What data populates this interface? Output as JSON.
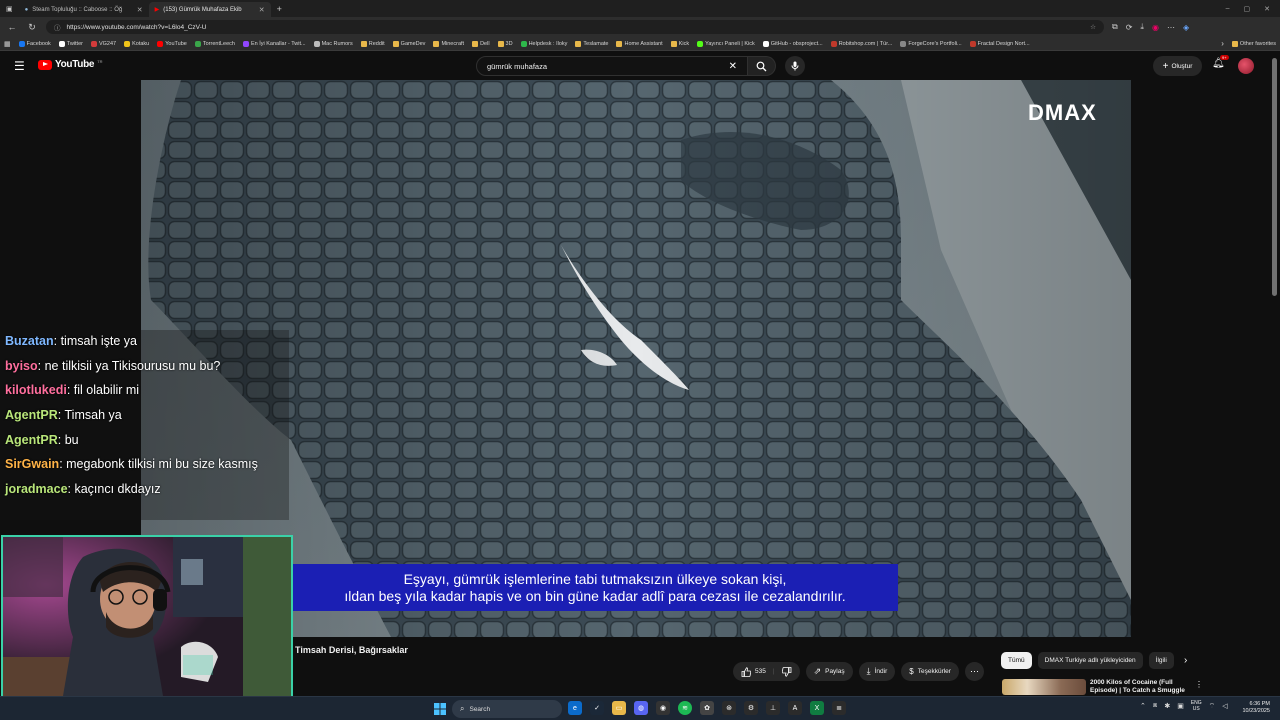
{
  "browser": {
    "tabs": [
      {
        "title": "Steam Topluluğu :: Caboose :: Öğ",
        "active": false
      },
      {
        "title": "(153) Gümrük Muhafaza Ekib",
        "active": true
      }
    ],
    "new_tab": "+",
    "window_controls": [
      "–",
      "▢",
      "✕"
    ],
    "url": "https://www.youtube.com/watch?v=L6lo4_CzV-U",
    "bookmarks": [
      {
        "label": "Facebook",
        "icon": "facebook-icon",
        "color": "#1877f2"
      },
      {
        "label": "Twitter",
        "icon": "x-icon",
        "color": "#ffffff"
      },
      {
        "label": "VG247",
        "icon": "vg247-icon",
        "color": "#d23b3b"
      },
      {
        "label": "Kotaku",
        "icon": "kotaku-icon",
        "color": "#f0c419"
      },
      {
        "label": "YouTube",
        "icon": "youtube-icon",
        "color": "#ff0000"
      },
      {
        "label": "TorrentLeech",
        "icon": "torrentleech-icon",
        "color": "#3aa64a"
      },
      {
        "label": "En İyi Kanallar - Twit...",
        "icon": "twitch-icon",
        "color": "#9146ff"
      },
      {
        "label": "Mac Rumors",
        "icon": "apple-icon",
        "color": "#bbbbbb"
      },
      {
        "label": "Reddit",
        "icon": "folder-icon",
        "color": "#e8b84a",
        "folder": true
      },
      {
        "label": "GameDev",
        "icon": "folder-icon",
        "color": "#e8b84a",
        "folder": true
      },
      {
        "label": "Minecraft",
        "icon": "folder-icon",
        "color": "#e8b84a",
        "folder": true
      },
      {
        "label": "Dell",
        "icon": "folder-icon",
        "color": "#e8b84a",
        "folder": true
      },
      {
        "label": "3D",
        "icon": "folder-icon",
        "color": "#e8b84a",
        "folder": true
      },
      {
        "label": "Helpdesk : Iloky",
        "icon": "helpdesk-icon",
        "color": "#2eb84b"
      },
      {
        "label": "Teslamate",
        "icon": "folder-icon",
        "color": "#e8b84a",
        "folder": true
      },
      {
        "label": "Home Assistant",
        "icon": "folder-icon",
        "color": "#e8b84a",
        "folder": true
      },
      {
        "label": "Kick",
        "icon": "folder-icon",
        "color": "#e8b84a",
        "folder": true
      },
      {
        "label": "Yayıncı Paneli | Kick",
        "icon": "kick-icon",
        "color": "#53fc18"
      },
      {
        "label": "GitHub - obsproject...",
        "icon": "github-icon",
        "color": "#ffffff"
      },
      {
        "label": "Robitshop.com | Tür...",
        "icon": "robitshop-icon",
        "color": "#c0392b"
      },
      {
        "label": "ForgeCore's Portfoli...",
        "icon": "forgecore-icon",
        "color": "#888888"
      },
      {
        "label": "Fractal Design Nort...",
        "icon": "fractal-icon",
        "color": "#c0392b"
      }
    ],
    "other_favorites": "Other favorites"
  },
  "youtube": {
    "logo_text": "YouTube",
    "logo_region": "TR",
    "search_query": "gümrük muhafaza",
    "create_label": "Oluştur",
    "notification_count": "9+",
    "video": {
      "watermark": "DMAX",
      "subtitle_lines": [
        "Eşyayı, gümrük işlemlerine tabi tutmaksızın ülkeye sokan kişi,",
        "ıldan beş yıla kadar hapis ve on bin güne kadar adlî para cezası ile cezalandırılır."
      ]
    },
    "video_title": "Timsah Derisi, Bağırsaklar",
    "actions": {
      "likes": "535",
      "share": "Paylaş",
      "download": "İndir",
      "thanks": "Teşekkürler",
      "more": "⋯"
    },
    "chips": [
      "Tümü",
      "DMAX Turkiye adlı yükleyiciden",
      "İlgili"
    ],
    "recommendation_title": "2000 Kilos of Cocaine (Full Episode) | To Catch a Smuggle"
  },
  "chat": [
    {
      "user": "Buzatan",
      "color": "#7fb8ff",
      "text": "timsah işte ya"
    },
    {
      "user": "byiso",
      "color": "#ff6f9e",
      "text": "ne tilkisii ya Tikisourusu mu bu?"
    },
    {
      "user": "kilotlukedi",
      "color": "#ff6f9e",
      "text": "fil olabilir mi"
    },
    {
      "user": "AgentPR",
      "color": "#b9e67a",
      "text": "Timsah ya"
    },
    {
      "user": "AgentPR",
      "color": "#b9e67a",
      "text": "bu"
    },
    {
      "user": "SirGwain",
      "color": "#ffb347",
      "text": "megabonk tilkisi mi bu size kasmış"
    },
    {
      "user": "joradmace",
      "color": "#b9e67a",
      "text": "kaçıncı dkdayız"
    }
  ],
  "taskbar": {
    "search_placeholder": "Search",
    "lang_line1": "ENG",
    "lang_line2": "US",
    "time": "6:36 PM",
    "date": "10/23/2025"
  },
  "colors": {
    "youtube_red": "#ff0000",
    "subtitle_bg": "#1b1fb4",
    "webcam_border": "#3ad1a8",
    "page_bg": "#0f0f0f"
  }
}
